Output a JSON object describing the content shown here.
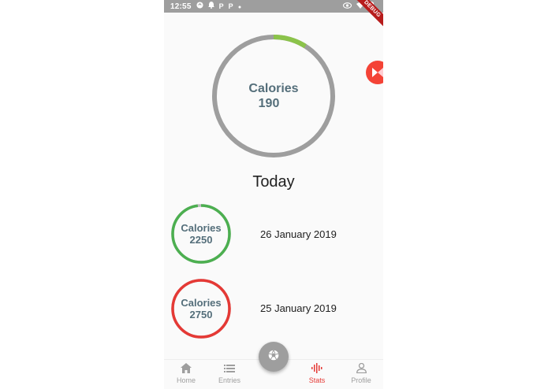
{
  "status_bar": {
    "time": "12:55",
    "left_icons": [
      "sync-icon",
      "notification-icon",
      "p-icon",
      "p-icon",
      "dot-icon"
    ],
    "p_glyph": "P",
    "right_icons": [
      "eye-icon",
      "wifi-icon",
      "battery-icon"
    ]
  },
  "debug_banner": "DEBUG",
  "main_ring": {
    "label": "Calories",
    "value": "190",
    "progress": 0.09,
    "progress_color": "#8bc34a",
    "track_color": "#9e9e9e"
  },
  "section_title": "Today",
  "entries": [
    {
      "label": "Calories",
      "value": "2250",
      "date": "26 January 2019",
      "ring_color": "#4caf50",
      "progress": 0.98
    },
    {
      "label": "Calories",
      "value": "2750",
      "date": "25 January 2019",
      "ring_color": "#e53935",
      "progress": 1.0
    }
  ],
  "fab": {
    "icon": "camera-shutter-icon"
  },
  "bottom_nav": {
    "items": [
      {
        "label": "Home",
        "icon": "home-icon",
        "active": false
      },
      {
        "label": "Entries",
        "icon": "list-icon",
        "active": false
      },
      {
        "label": "Stats",
        "icon": "stats-icon",
        "active": true
      },
      {
        "label": "Profile",
        "icon": "profile-icon",
        "active": false
      }
    ],
    "active_color": "#e53935",
    "inactive_color": "#9e9e9e"
  },
  "floating_bubble": {
    "icon": "bubble-logo-icon",
    "color": "#f44336"
  }
}
